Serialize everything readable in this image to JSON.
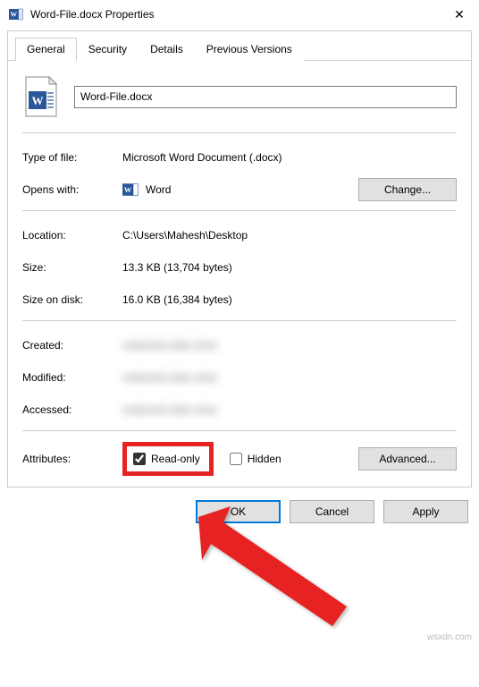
{
  "window": {
    "title": "Word-File.docx Properties"
  },
  "tabs": {
    "general": "General",
    "security": "Security",
    "details": "Details",
    "previous_versions": "Previous Versions"
  },
  "filename": "Word-File.docx",
  "rows": {
    "type_label": "Type of file:",
    "type_value": "Microsoft Word Document (.docx)",
    "opens_label": "Opens with:",
    "opens_value": "Word",
    "change_btn": "Change...",
    "location_label": "Location:",
    "location_value": "C:\\Users\\Mahesh\\Desktop",
    "size_label": "Size:",
    "size_value": "13.3 KB (13,704 bytes)",
    "sizeondisk_label": "Size on disk:",
    "sizeondisk_value": "16.0 KB (16,384 bytes)",
    "created_label": "Created:",
    "modified_label": "Modified:",
    "accessed_label": "Accessed:"
  },
  "attributes": {
    "label": "Attributes:",
    "readonly_label": "Read-only",
    "readonly_checked": true,
    "hidden_label": "Hidden",
    "hidden_checked": false,
    "advanced_btn": "Advanced..."
  },
  "footer": {
    "ok": "OK",
    "cancel": "Cancel",
    "apply": "Apply"
  },
  "watermark": "wsxdn.com"
}
